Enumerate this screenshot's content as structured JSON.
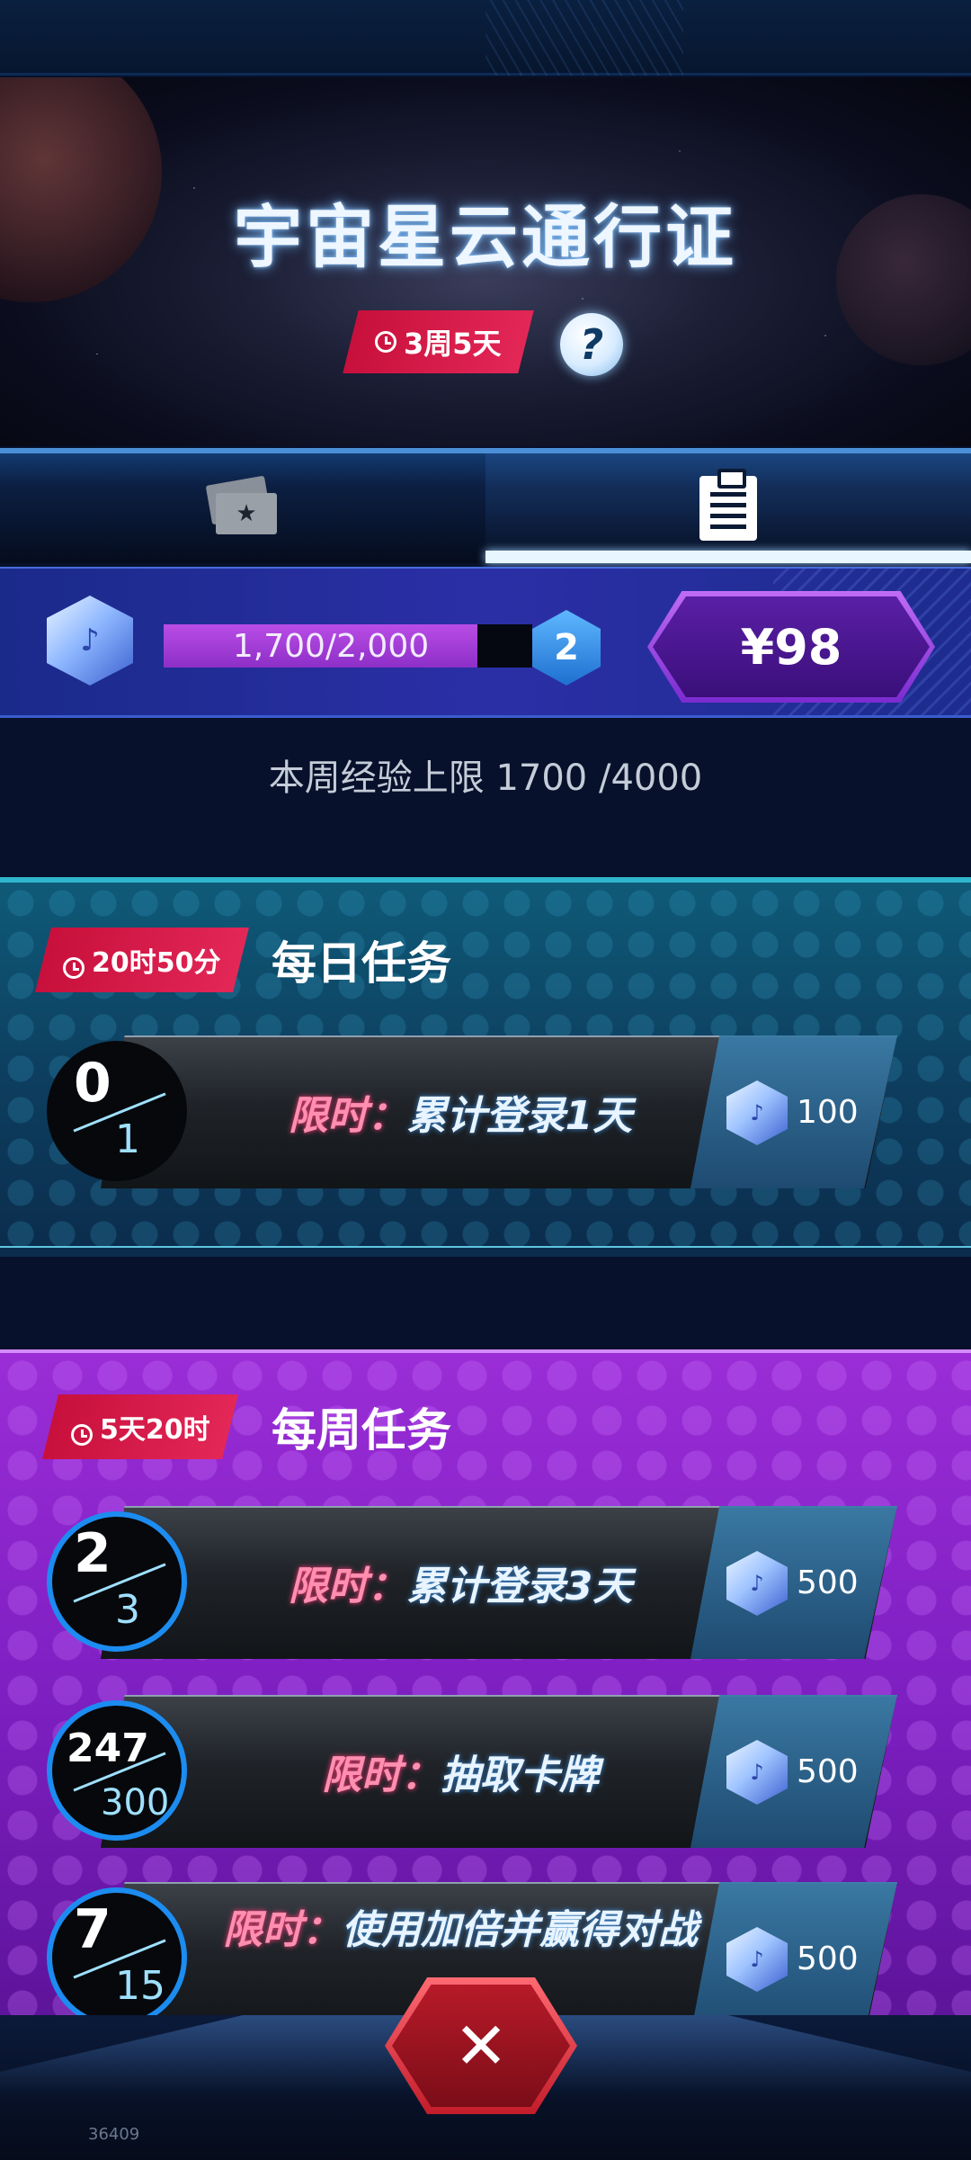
{
  "header": {
    "title": "宇宙星云通行证",
    "season_time_left": "3周5天",
    "help_symbol": "?"
  },
  "tabs": [
    {
      "name": "rewards",
      "icon": "ticket-star-icon",
      "selected": false
    },
    {
      "name": "missions",
      "icon": "clipboard-icon",
      "selected": true
    }
  ],
  "progress": {
    "xp_text": "1,700/2,000",
    "xp_fraction": 0.85,
    "level": "2",
    "price_label": "¥98"
  },
  "weekly_cap_text": "本周经验上限 1700 /4000",
  "daily": {
    "timer": "20时50分",
    "title": "每日任务",
    "tasks": [
      {
        "progress_current": "0",
        "progress_total": "1",
        "prefix": "限时：",
        "name": "累计登录1天",
        "reward": "100"
      }
    ]
  },
  "weekly": {
    "timer": "5天20时",
    "title": "每周任务",
    "tasks": [
      {
        "progress_current": "2",
        "progress_total": "3",
        "prefix": "限时：",
        "name": "累计登录3天",
        "reward": "500"
      },
      {
        "progress_current": "247",
        "progress_total": "300",
        "prefix": "限时：",
        "name": "抽取卡牌",
        "reward": "500"
      },
      {
        "progress_current": "7",
        "progress_total": "15",
        "prefix": "限时：",
        "name": "使用加倍并赢得对战",
        "reward": "500"
      }
    ]
  },
  "close_symbol": "✕",
  "build_number": "36409",
  "colors": {
    "accent_red": "#e32757",
    "weekly_purple": "#8e26cc",
    "daily_teal": "#0f5a78",
    "progress_ring": "#1c8cf0"
  }
}
